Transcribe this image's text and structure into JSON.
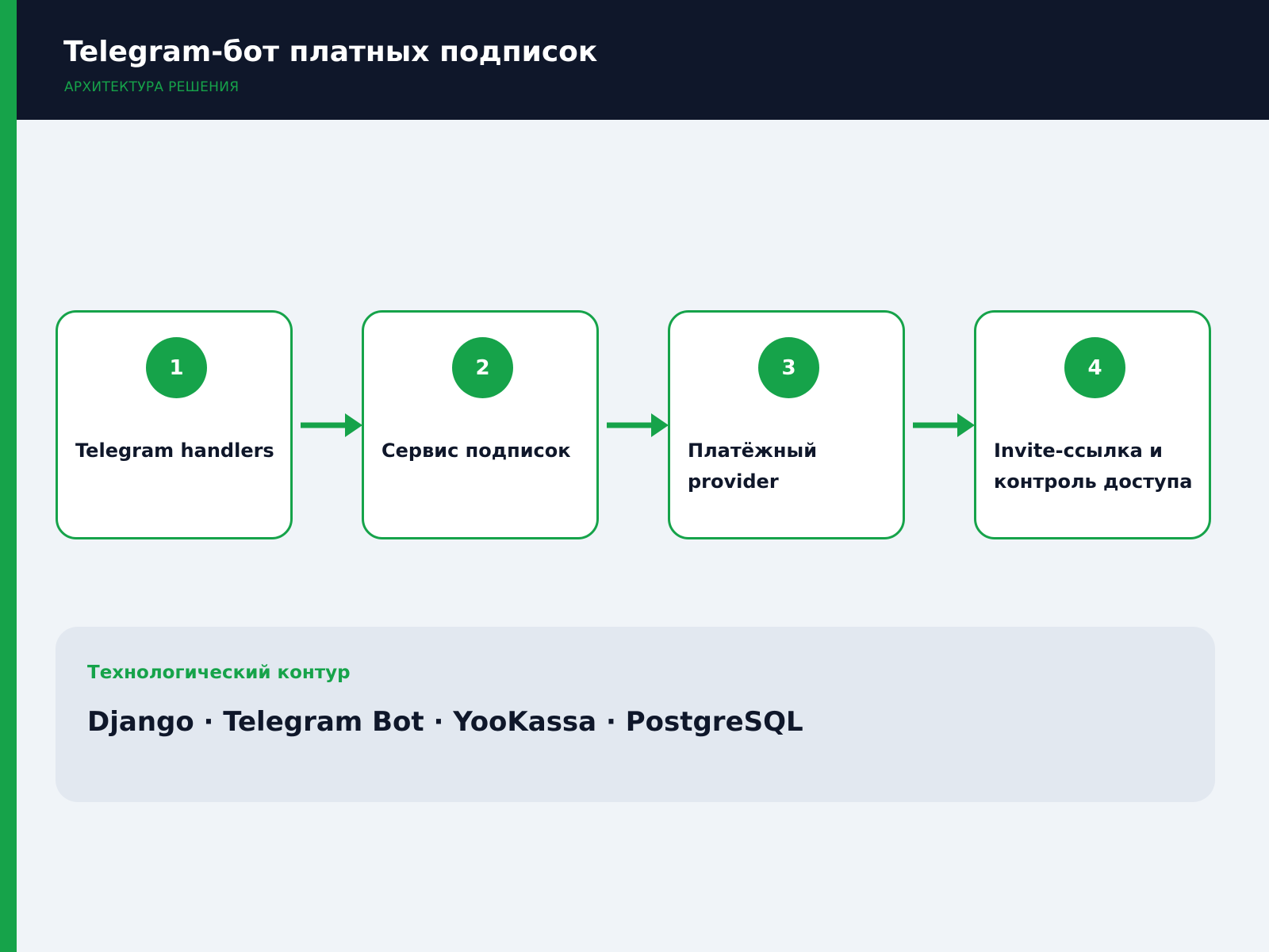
{
  "header": {
    "title": "Telegram-бот платных подписок",
    "subtitle": "АРХИТЕКТУРА РЕШЕНИЯ"
  },
  "steps": [
    {
      "number": "1",
      "label": "Telegram handlers"
    },
    {
      "number": "2",
      "label": "Сервис подписок"
    },
    {
      "number": "3",
      "label": "Платёжный provider"
    },
    {
      "number": "4",
      "label": "Invite-ссылка и контроль доступа"
    }
  ],
  "stack": {
    "heading": "Технологический контур",
    "value": "Django · Telegram Bot · YooKassa · PostgreSQL"
  },
  "colors": {
    "accent": "#16a34a",
    "header_bg": "#0f172a",
    "page_bg": "#f0f4f8",
    "panel_bg": "#e2e8f0",
    "text_dark": "#0f172a"
  }
}
